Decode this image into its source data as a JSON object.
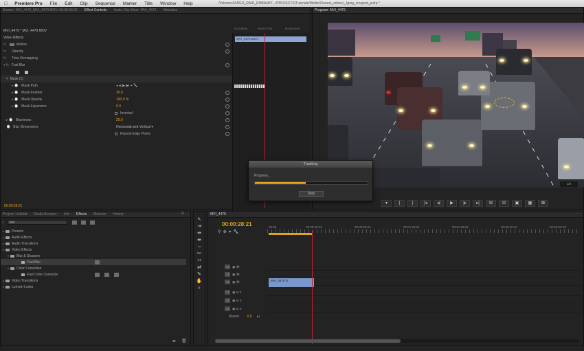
{
  "menubar": {
    "app": "Premiere Pro",
    "items": [
      "File",
      "Edit",
      "Clip",
      "Sequence",
      "Marker",
      "Title",
      "Window",
      "Help"
    ],
    "path": "/Volumes/VIDEO_RAID_EMBANKT.../PROJECTS/Tutorials/Mettle/Cloned_videos/_Jgoig_cropped_pulrp *"
  },
  "effect_controls": {
    "tabs": [
      "Source: MVI_4479_MVI_4479.MOV: 00:00:03:00",
      "Effect Controls",
      "Audio Clip Mixer: MVI_4479",
      "Metadata"
    ],
    "active_tab": "Effect Controls",
    "clip_path": "MVI_4479 * MVI_4479.MOV",
    "section": "Video Effects",
    "rows": [
      {
        "label": "Motion",
        "value": ""
      },
      {
        "label": "Opacity",
        "value": ""
      },
      {
        "label": "Time Remapping",
        "value": ""
      },
      {
        "label": "Fast Blur",
        "value": ""
      },
      {
        "label": "",
        "value": ""
      },
      {
        "label": "Mask (1)",
        "value": ""
      },
      {
        "label": "Mask Path",
        "value": ""
      },
      {
        "label": "Mask Feather",
        "value": "20.0"
      },
      {
        "label": "Mask Opacity",
        "value": "100.0 %"
      },
      {
        "label": "Mask Expansion",
        "value": "0.0"
      },
      {
        "label": "Inverted",
        "value": ""
      },
      {
        "label": "Blurriness",
        "value": "25.0"
      },
      {
        "label": "Blur Dimensions",
        "value": "Horizontal and Vertical"
      },
      {
        "label": "",
        "value": "Repeat Edge Pixels"
      }
    ],
    "timecode": "00:00:28:21",
    "ruler": [
      "0:00:26:00",
      "00:00:27:00",
      "00:00:28:00"
    ],
    "clip_name": "MVI_4479.MOV"
  },
  "program_monitor": {
    "tab": "Program: MVI_4479",
    "zoom": "1/4",
    "transport": [
      "▾",
      "{",
      "}",
      "|◂",
      "◂|",
      "▶",
      "|▸",
      "▸|",
      "⊞",
      "⊟",
      "▣",
      "▦",
      "⊠"
    ]
  },
  "tracking_dialog": {
    "title": "Tracking",
    "label": "Progress...",
    "progress": 0.45,
    "stop_label": "Stop"
  },
  "project_panel": {
    "tabs": [
      "Project: Untitled",
      "Media Browser",
      "Info",
      "Effects",
      "Markers",
      "History"
    ],
    "active_tab": "Effects",
    "search": "blur",
    "items": [
      {
        "label": "Presets",
        "indent": 0
      },
      {
        "label": "Audio Effects",
        "indent": 0
      },
      {
        "label": "Audio Transitions",
        "indent": 0
      },
      {
        "label": "Video Effects",
        "indent": 0
      },
      {
        "label": "Blur & Sharpen",
        "indent": 1
      },
      {
        "label": "Fast Blur",
        "indent": 2
      },
      {
        "label": "Color Correction",
        "indent": 1
      },
      {
        "label": "Fast Color Corrector",
        "indent": 2
      },
      {
        "label": "Video Transitions",
        "indent": 0
      },
      {
        "label": "Lumetri Looks",
        "indent": 0
      }
    ]
  },
  "timeline": {
    "tab": "MVI_4479",
    "timecode": "00:00:28:21",
    "ruler": [
      "00:00",
      "00:00:29:23",
      "00:00:59:22",
      "00:01:29:21",
      "00:01:59:21",
      "00:02:29:20",
      "00:02:59:19"
    ],
    "tracks": [
      {
        "name": "V3"
      },
      {
        "name": "V2"
      },
      {
        "name": "V1"
      },
      {
        "name": "A1"
      },
      {
        "name": "A2"
      },
      {
        "name": "A3"
      }
    ],
    "clip": "MVI_4479  fx",
    "master_label": "Master",
    "master_value": "0.0"
  }
}
